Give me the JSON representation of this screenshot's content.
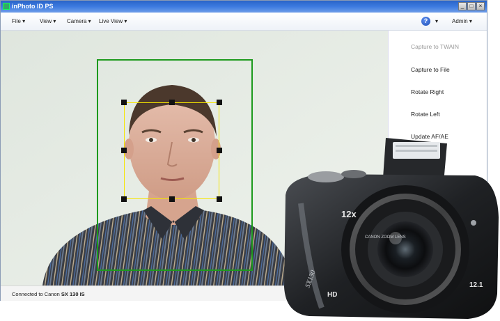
{
  "window": {
    "title": "inPhoto ID PS",
    "controls": [
      "minimize",
      "maximize",
      "close"
    ]
  },
  "menu": {
    "file": "File ▾",
    "view": "View ▾",
    "camera": "Camera ▾",
    "live_view": "Live View ▾",
    "help_icon": "?",
    "help_arrow": "▾",
    "admin": "Admin ▾"
  },
  "sidebar": {
    "items": [
      {
        "label": "Capture to TWAIN",
        "enabled": false
      },
      {
        "label": "Capture to File",
        "enabled": true
      },
      {
        "label": "Rotate Right",
        "enabled": true
      },
      {
        "label": "Rotate Left",
        "enabled": true
      },
      {
        "label": "Update AF/AE",
        "enabled": true
      }
    ]
  },
  "status": {
    "prefix": "Connected to Canon",
    "model": "SX 130 IS"
  },
  "camera_labels": {
    "zoom": "12x",
    "brand": "CANON ZOOM LENS",
    "model": "SX130",
    "mp": "12.1",
    "hd": "HD"
  },
  "colors": {
    "titlebar": "#2a64c8",
    "green_frame": "#1d9a1d",
    "crop_box": "#f5e500",
    "background": "#e6ebe5"
  }
}
